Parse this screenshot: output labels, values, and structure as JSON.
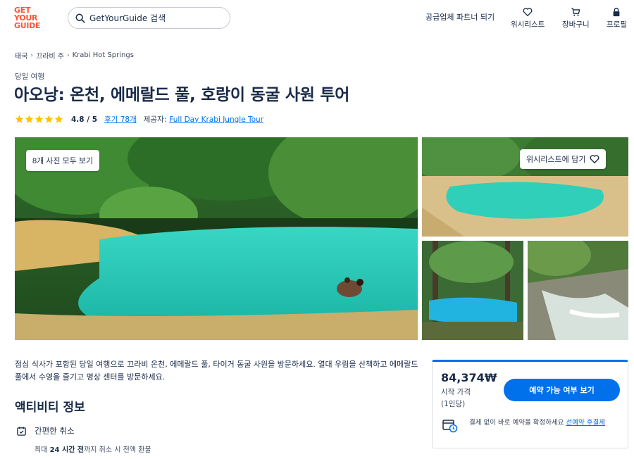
{
  "brand": {
    "logo_lines": [
      "GET",
      "YOUR",
      "GUIDE"
    ],
    "color": "#ff5533",
    "accent": "#0071eb"
  },
  "header": {
    "search_placeholder": "GetYourGuide 검색",
    "partner_link": "공급업체 파트너 되기",
    "wishlist": "위시리스트",
    "cart": "장바구니",
    "profile": "프로필"
  },
  "breadcrumb": [
    "태국",
    "끄라비 주",
    "Krabi Hot Springs"
  ],
  "activity": {
    "kicker": "당일 여행",
    "title": "아오낭: 온천, 에메랄드 풀, 호랑이 동굴 사원 투어",
    "rating": "4.8 / 5",
    "stars": 5,
    "reviews": "후기 78개",
    "provider_label": "제공자:",
    "provider": "Full Day Krabi Jungle Tour"
  },
  "gallery": {
    "all_photos": "8개 사진 모두 보기",
    "wishlist_button": "위시리스트에 담기"
  },
  "description": "점심 식사가 포함된 당일 여행으로 끄라비 온천, 에메랄드 풀, 타이거 동굴 사원을 방문하세요. 열대 우림을 산책하고 에메랄드 풀에서 수영을 즐기고 명상 센터를 방문하세요.",
  "info": {
    "section_title": "액티비티 정보",
    "cancel_title": "간편한 취소",
    "cancel_sub_pre": "최대",
    "cancel_sub_bold": "24 시간 전",
    "cancel_sub_post": "까지 취소 시 전액 환불"
  },
  "booking": {
    "price": "84,374₩",
    "price_label": "시작 가격",
    "price_unit": "(1인당)",
    "check_button": "예약 가능 여부 보기",
    "reserve_text": "결제 없이 바로 예약을 확정하세요 ",
    "reserve_link": "선예약 후결제"
  }
}
